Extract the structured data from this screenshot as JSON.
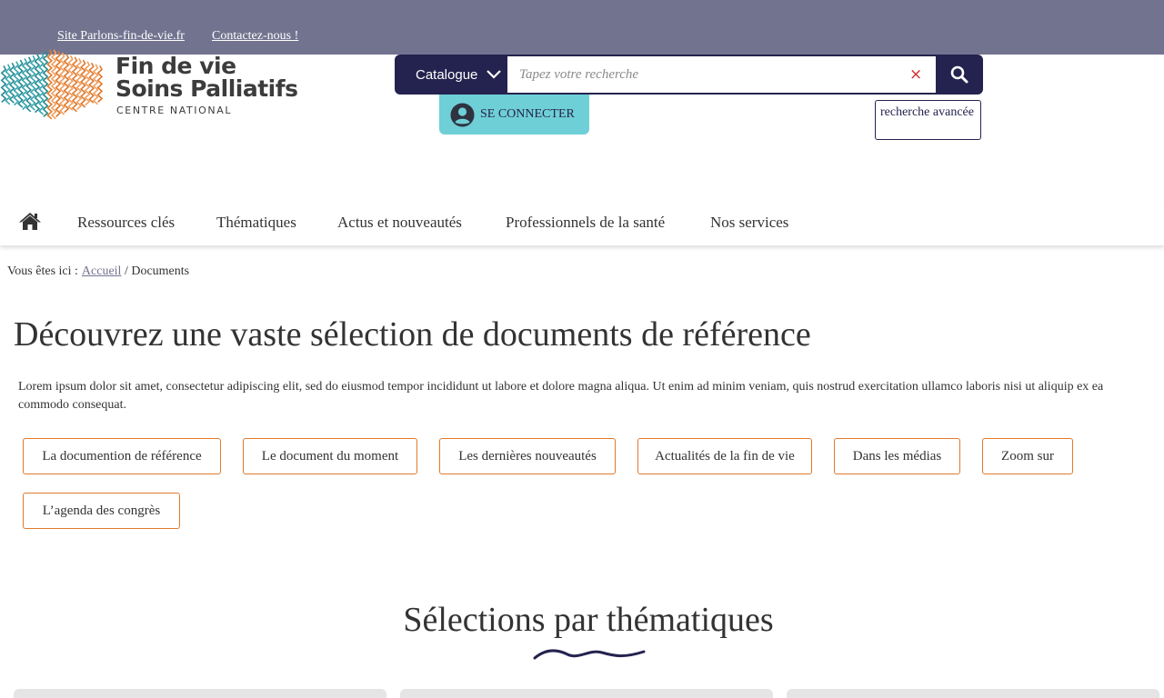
{
  "topbar": {
    "link1": "Site Parlons-fin-de-vie.fr",
    "link2": "Contactez-nous !"
  },
  "logo": {
    "line1": "Fin de vie",
    "line2": "Soins Palliatifs",
    "line3": "CENTRE NATIONAL"
  },
  "search": {
    "catalogue_label": "Catalogue",
    "placeholder": "Tapez votre recherche",
    "clear_symbol": "×",
    "connect_label": "SE CONNECTER",
    "advanced_label": "recherche avancée"
  },
  "nav": {
    "items": [
      "Ressources clés",
      "Thématiques",
      "Actus et nouveautés",
      "Professionnels de la santé",
      "Nos services"
    ]
  },
  "breadcrumb": {
    "prefix": "Vous êtes ici :",
    "home": "Accueil",
    "separator": "/",
    "current": "Documents"
  },
  "main": {
    "title": "Découvrez une vaste sélection de documents de référence",
    "intro": "Lorem ipsum dolor sit amet, consectetur adipiscing elit, sed do eiusmod tempor incididunt ut labore et dolore magna aliqua. Ut enim ad minim veniam, quis nostrud exercitation ullamco laboris nisi ut aliquip ex ea commodo consequat.",
    "chips": [
      "La documention de référence",
      "Le document du moment",
      "Les dernières nouveautés",
      "Actualités de la fin de vie",
      "Dans les médias",
      "Zoom sur",
      "L’agenda des congrès"
    ]
  },
  "selections": {
    "title": "Sélections par thématiques"
  },
  "colors": {
    "topbar": "#72738f",
    "navy": "#24234f",
    "teal": "#6fcfd7",
    "orange_border": "#e07a2e"
  },
  "icons": [
    "chevron-down-icon",
    "search-icon",
    "user-icon",
    "home-icon",
    "close-icon"
  ]
}
